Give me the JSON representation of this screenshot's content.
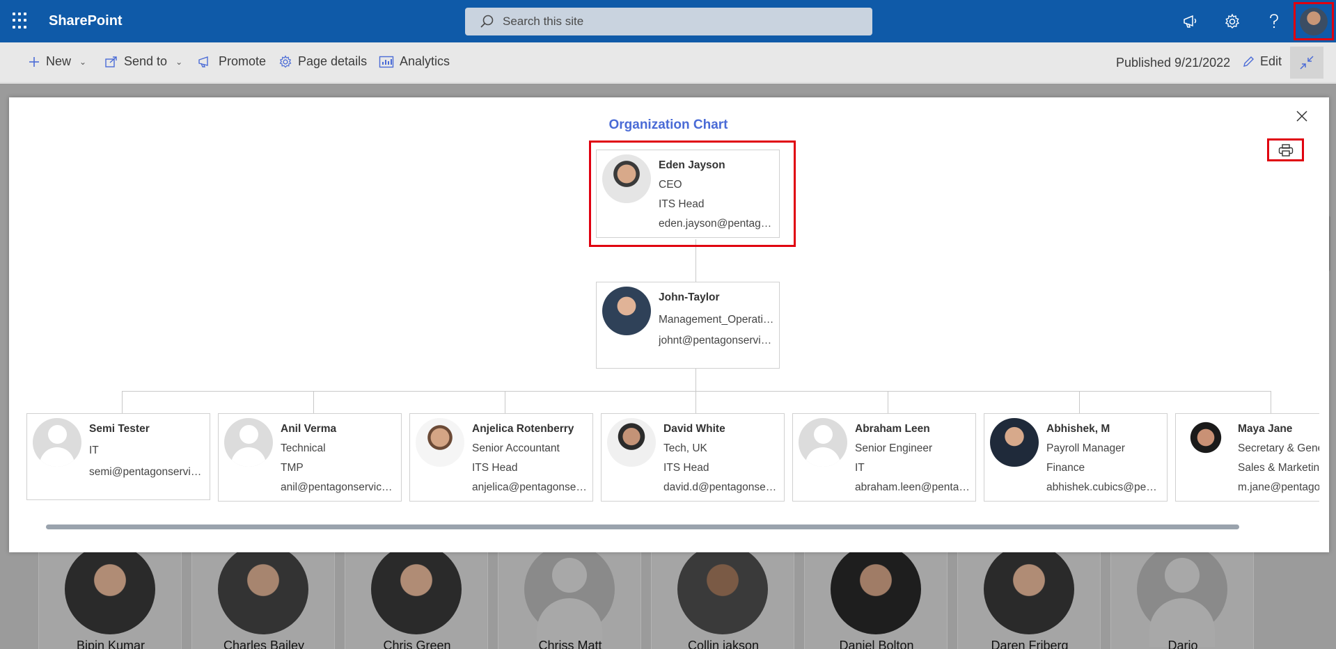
{
  "suitebar": {
    "app_name": "SharePoint",
    "search_placeholder": "Search this site",
    "icons": [
      "waffle-icon",
      "megaphone-icon",
      "gear-icon",
      "help-icon",
      "profile-avatar"
    ]
  },
  "commandbar": {
    "new_label": "New",
    "send_to_label": "Send to",
    "promote_label": "Promote",
    "page_details_label": "Page details",
    "analytics_label": "Analytics",
    "published_label": "Published 9/21/2022",
    "edit_label": "Edit"
  },
  "modal": {
    "title": "Organization Chart",
    "root": {
      "name": "Eden Jayson",
      "line1": "CEO",
      "line2": "ITS Head",
      "email": "eden.jayson@pentagonservices.com"
    },
    "manager": {
      "name": "John-Taylor",
      "line1": "Management_Operations",
      "email": "johnt@pentagonservices.com"
    },
    "reports": [
      {
        "name": "Semi Tester",
        "line1": "IT",
        "line2": "",
        "email": "semi@pentagonservices.com"
      },
      {
        "name": "Anil Verma",
        "line1": "Technical",
        "line2": "TMP",
        "email": "anil@pentagonservices.com"
      },
      {
        "name": "Anjelica Rotenberry",
        "line1": "Senior Accountant",
        "line2": "ITS Head",
        "email": "anjelica@pentagonservices.com"
      },
      {
        "name": "David White",
        "line1": "Tech, UK",
        "line2": "ITS Head",
        "email": "david.d@pentagonservices.com"
      },
      {
        "name": "Abraham Leen",
        "line1": "Senior Engineer",
        "line2": "IT",
        "email": "abraham.leen@pentagonservices.com"
      },
      {
        "name": "Abhishek, M",
        "line1": "Payroll Manager",
        "line2": "Finance",
        "email": "abhishek.cubics@pentagonservices.com"
      },
      {
        "name": "Maya Jane",
        "line1": "Secretary & General",
        "line2": "Sales & Marketing",
        "email": "m.jane@pentagonservices.com"
      }
    ]
  },
  "background_people": [
    "Bipin Kumar",
    "Charles Bailey",
    "Chris Green",
    "Chriss Matt",
    "Collin jakson",
    "Daniel Bolton",
    "Daren Friberg",
    "Dario"
  ]
}
